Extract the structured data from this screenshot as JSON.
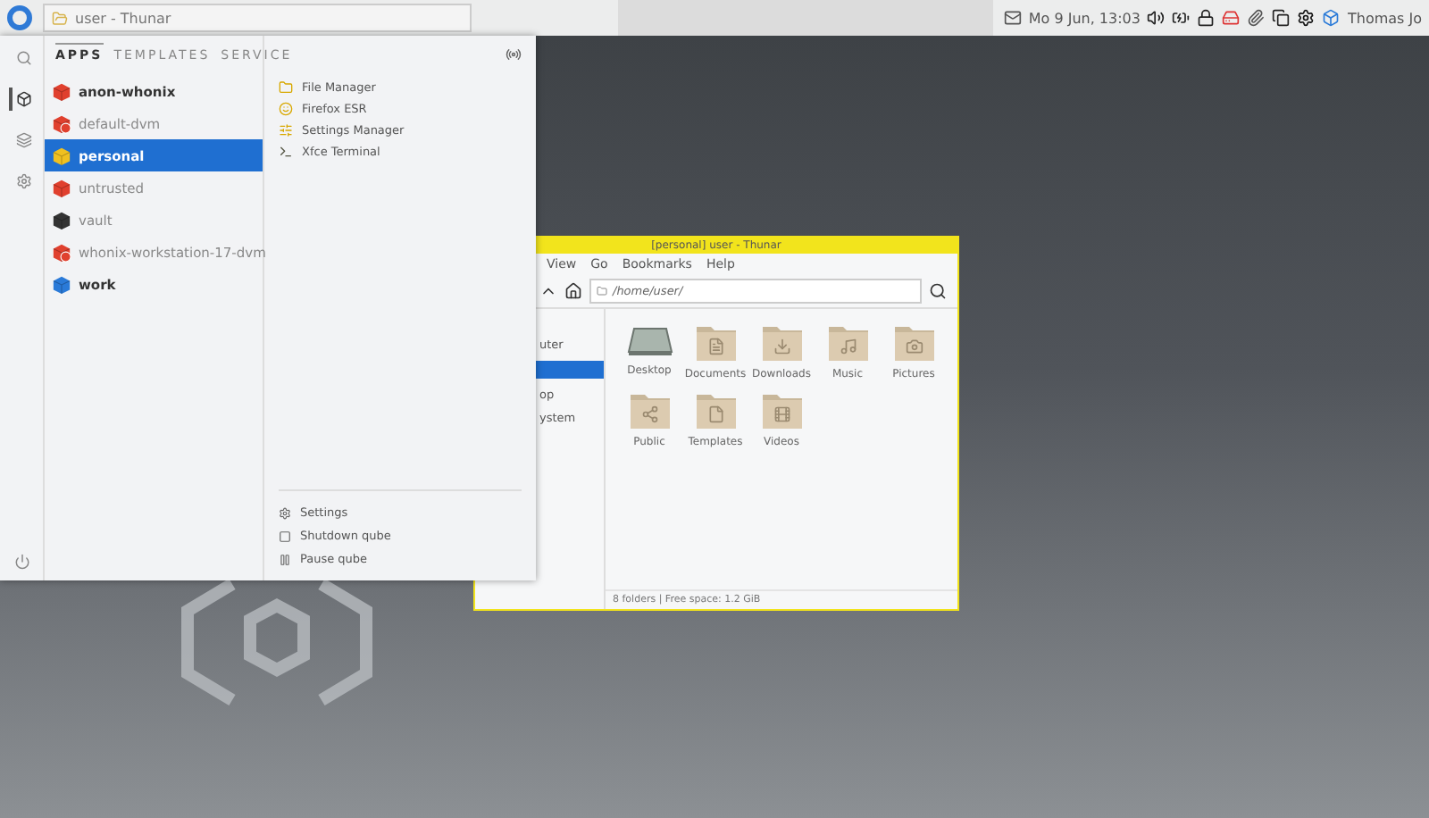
{
  "taskbar": {
    "task": {
      "title": "user - Thunar"
    },
    "clock": "Mo 9 Jun, 13:03",
    "user": "Thomas Jo"
  },
  "menu": {
    "side": [
      {
        "kind": "search",
        "selected": false
      },
      {
        "kind": "qubes",
        "selected": true
      },
      {
        "kind": "templates",
        "selected": false
      },
      {
        "kind": "settings",
        "selected": false
      }
    ],
    "tabs": [
      {
        "label": "APPS",
        "selected": true
      },
      {
        "label": "TEMPLATES",
        "selected": false
      },
      {
        "label": "SERVICE",
        "selected": false
      }
    ],
    "qubes": [
      {
        "name": "anon-whonix",
        "color": "#e0402e",
        "kind": "qube",
        "running": true,
        "selected": false
      },
      {
        "name": "default-dvm",
        "color": "#e0402e",
        "kind": "dvm",
        "running": false,
        "selected": false
      },
      {
        "name": "personal",
        "color": "#f0c020",
        "kind": "qube",
        "running": true,
        "selected": true
      },
      {
        "name": "untrusted",
        "color": "#e0402e",
        "kind": "qube",
        "running": false,
        "selected": false
      },
      {
        "name": "vault",
        "color": "#333333",
        "kind": "qube",
        "running": false,
        "selected": false
      },
      {
        "name": "whonix-workstation-17-dvm",
        "color": "#e0402e",
        "kind": "dvm",
        "running": false,
        "selected": false
      },
      {
        "name": "work",
        "color": "#2a7ad8",
        "kind": "qube",
        "running": true,
        "selected": false
      }
    ],
    "apps": [
      {
        "label": "File Manager",
        "kind": "files"
      },
      {
        "label": "Firefox ESR",
        "kind": "browser"
      },
      {
        "label": "Settings Manager",
        "kind": "settings"
      },
      {
        "label": "Xfce Terminal",
        "kind": "terminal"
      }
    ],
    "actions": [
      {
        "label": "Settings",
        "kind": "settings"
      },
      {
        "label": "Shutdown qube",
        "kind": "shutdown"
      },
      {
        "label": "Pause qube",
        "kind": "pause"
      }
    ]
  },
  "thunar": {
    "title": "[personal] user - Thunar",
    "color": "#f2e41c",
    "menu": [
      "View",
      "Go",
      "Bookmarks",
      "Help"
    ],
    "path": "/home/user/",
    "places": [
      {
        "label": "uter",
        "selected": false
      },
      {
        "selected": true
      },
      {
        "label": "op",
        "selected": false
      },
      {
        "label": "ystem",
        "selected": false
      }
    ],
    "folders": [
      {
        "name": "Desktop",
        "kind": "desktop"
      },
      {
        "name": "Documents",
        "kind": "documents"
      },
      {
        "name": "Downloads",
        "kind": "downloads"
      },
      {
        "name": "Music",
        "kind": "music"
      },
      {
        "name": "Pictures",
        "kind": "pictures"
      },
      {
        "name": "Public",
        "kind": "public"
      },
      {
        "name": "Templates",
        "kind": "templates"
      },
      {
        "name": "Videos",
        "kind": "videos"
      }
    ],
    "status": "8 folders | Free space: 1.2 GiB"
  }
}
